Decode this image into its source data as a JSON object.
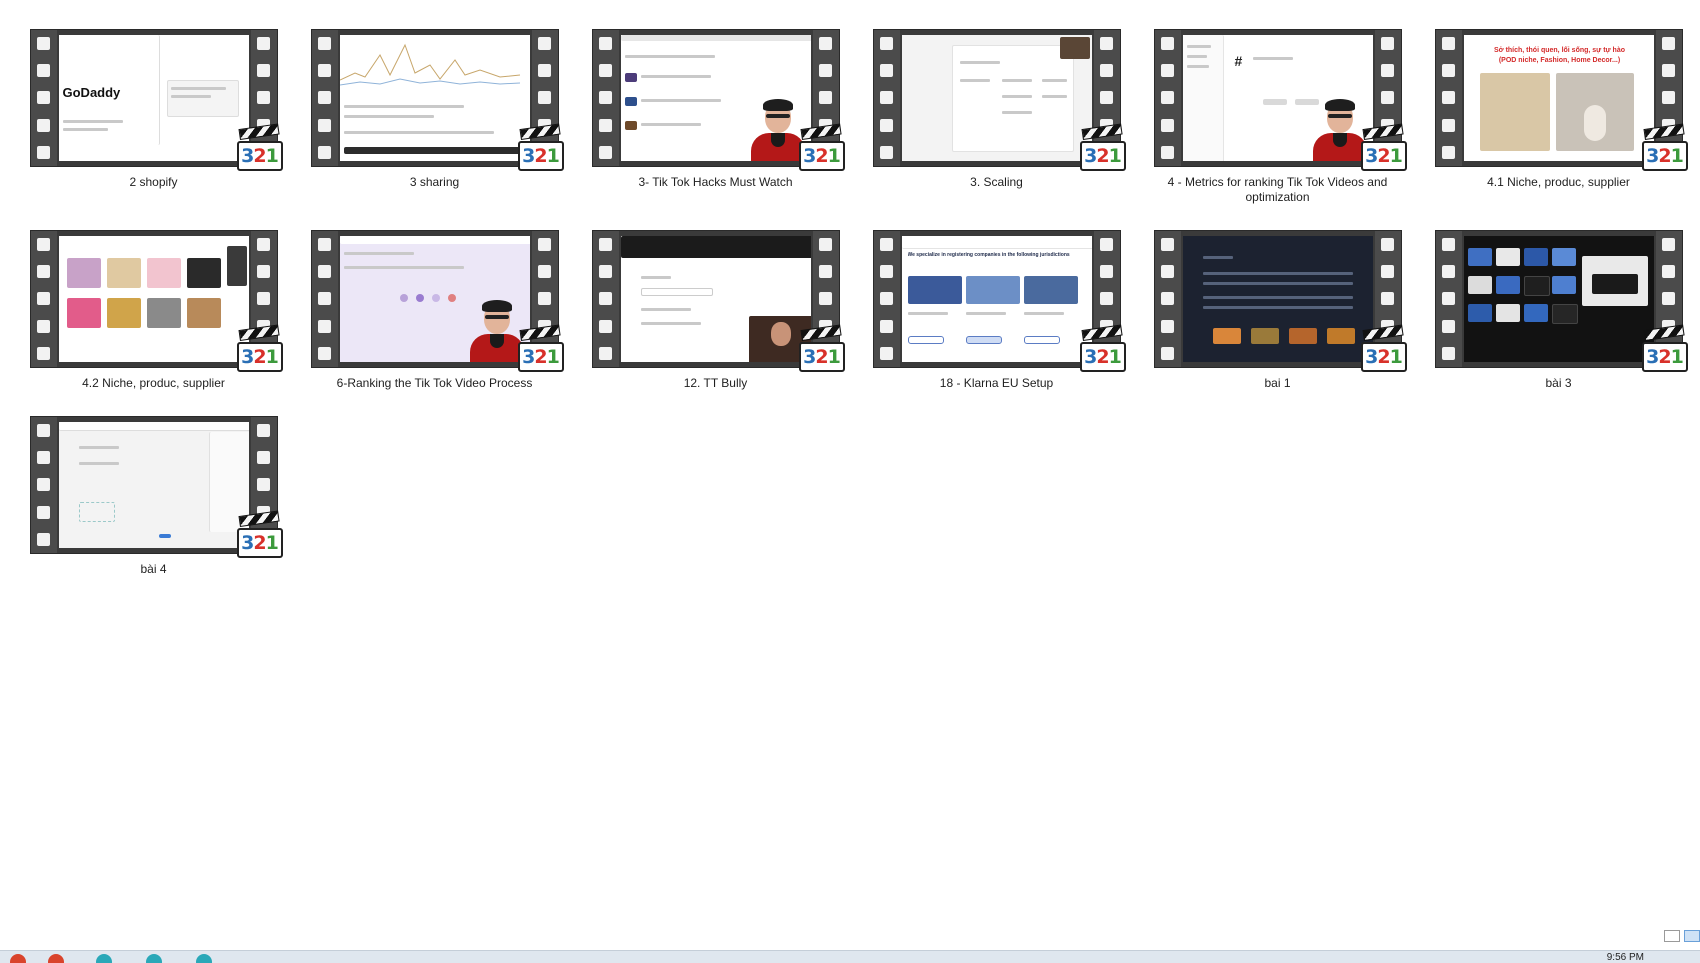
{
  "files": [
    {
      "name": "2 shopify"
    },
    {
      "name": "3 sharing"
    },
    {
      "name": "3- Tik Tok Hacks Must Watch"
    },
    {
      "name": "3. Scaling"
    },
    {
      "name": "4 - Metrics for ranking Tik Tok Videos and optimization"
    },
    {
      "name": "4.1 Niche, produc, supplier"
    },
    {
      "name": "4.2 Niche, produc, supplier"
    },
    {
      "name": "6-Ranking the Tik Tok Video Process"
    },
    {
      "name": "12. TT Bully"
    },
    {
      "name": "18 - Klarna EU Setup"
    },
    {
      "name": "bai 1"
    },
    {
      "name": "bài 3"
    },
    {
      "name": "bài 4"
    }
  ],
  "thumb_text": {
    "godaddy": "GoDaddy",
    "niche_banner_line1": "Sở thích, thói quen, lối sống, sự tự hào",
    "niche_banner_line2": "(POD niche, Fashion, Home Decor...)",
    "hashtag": "#",
    "klarna_heading": "We specialize in registering companies in the following jurisdictions"
  },
  "badge": {
    "digit_3": "3",
    "digit_2": "2",
    "digit_1": "1"
  },
  "taskbar": {
    "clock": "9:56 PM"
  },
  "colors": {
    "background": "#ffffff",
    "badge_3": "#2a6fb5",
    "badge_2": "#d8312a",
    "badge_1": "#3c9a3c",
    "film_strip": "#4b4b4b",
    "taskbar": "#dfe7ef"
  },
  "icons": [
    "mpc-hc-321-icon",
    "film-strip-icon",
    "details-view-icon",
    "large-icons-view-icon"
  ]
}
